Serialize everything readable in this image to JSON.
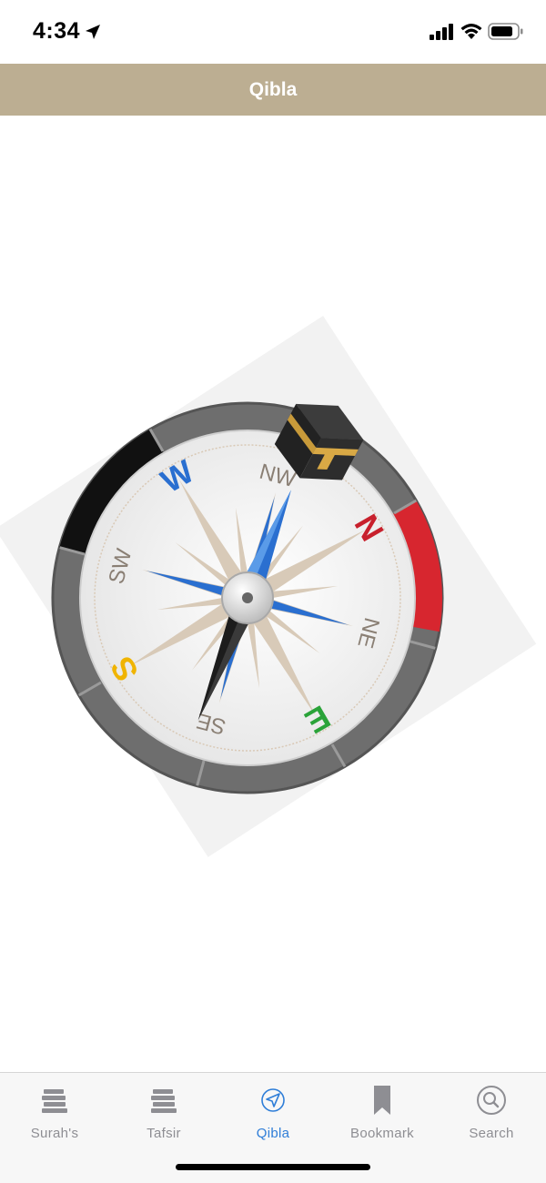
{
  "status": {
    "time": "4:34"
  },
  "header": {
    "title": "Qibla"
  },
  "compass": {
    "directions": {
      "n": "N",
      "s": "S",
      "e": "E",
      "w": "W",
      "ne": "NE",
      "nw": "NW",
      "se": "SE",
      "sw": "SW"
    },
    "colors": {
      "n": "#c8202c",
      "s": "#f0b400",
      "e": "#2aa339",
      "w": "#2a6fd0",
      "intercardinal": "#8a7f74"
    }
  },
  "tabs": [
    {
      "label": "Surah's",
      "icon": "books-icon"
    },
    {
      "label": "Tafsir",
      "icon": "books-icon"
    },
    {
      "label": "Qibla",
      "icon": "navigation-arrow-icon",
      "active": true
    },
    {
      "label": "Bookmark",
      "icon": "bookmark-icon"
    },
    {
      "label": "Search",
      "icon": "search-icon"
    }
  ],
  "accent": "#2f7ed8",
  "header_color": "#bcae92"
}
